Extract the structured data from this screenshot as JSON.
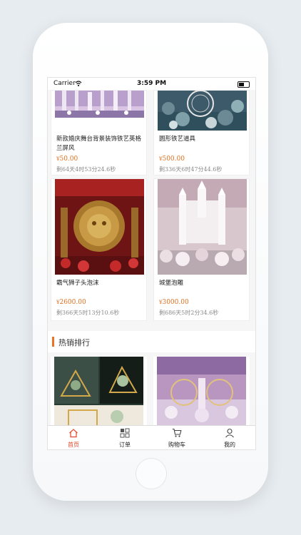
{
  "status_bar": {
    "carrier": "Carrier",
    "time": "3:59 PM"
  },
  "products": [
    {
      "title": "新款婚庆舞台背景装饰铁艺英格兰屏风",
      "currency": "¥",
      "price": "50.00",
      "countdown": "剩64天4时53分24.6秒"
    },
    {
      "title": "圆形铁艺道具",
      "currency": "¥",
      "price": "500.00",
      "countdown": "剩336天6时47分44.6秒"
    },
    {
      "title": "霸气狮子头泡沫",
      "currency": "¥",
      "price": "2600.00",
      "countdown": "剩366天5时13分10.6秒"
    },
    {
      "title": "城堡泡雕",
      "currency": "¥",
      "price": "3000.00",
      "countdown": "剩686天5时2分34.6秒"
    }
  ],
  "hot_section": {
    "title": "热销排行"
  },
  "tabs": [
    {
      "label": "首页",
      "icon": "home-icon",
      "active": true
    },
    {
      "label": "订单",
      "icon": "grid-icon",
      "active": false
    },
    {
      "label": "购物车",
      "icon": "cart-icon",
      "active": false
    },
    {
      "label": "我的",
      "icon": "user-icon",
      "active": false
    }
  ],
  "colors": {
    "accent": "#e0452b",
    "price": "#e07020",
    "section_bar": "#e8742a"
  }
}
